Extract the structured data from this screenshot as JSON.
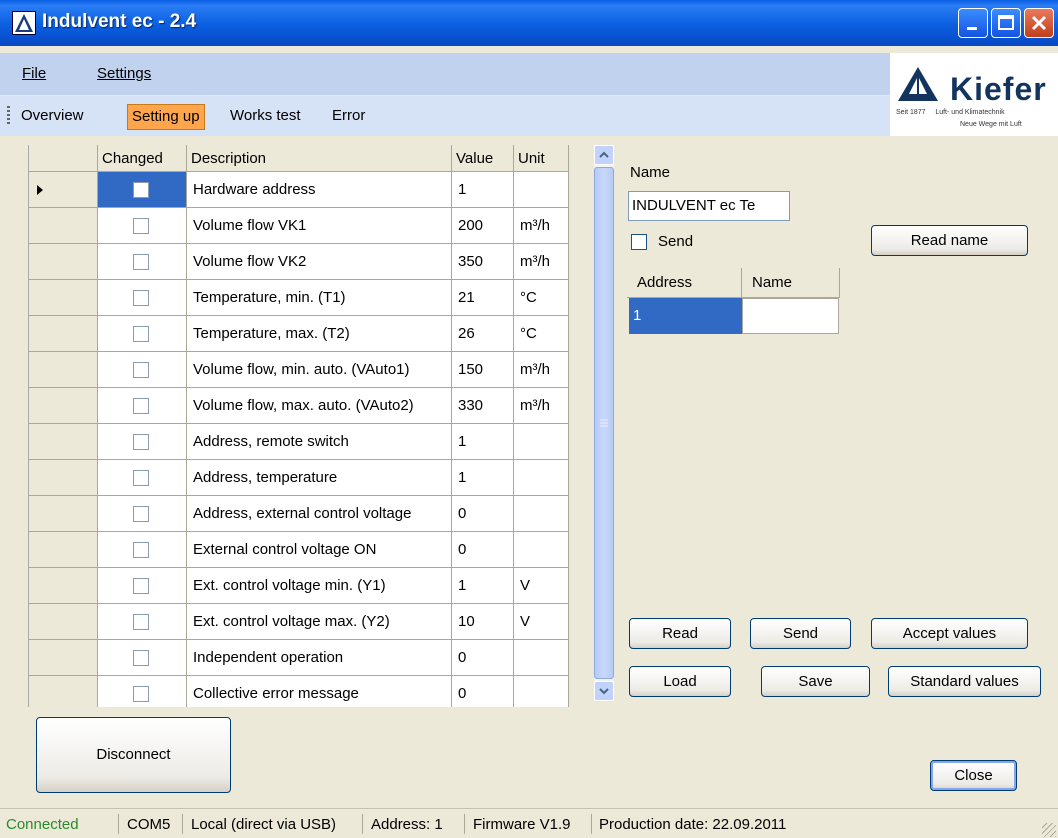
{
  "window": {
    "title": "Indulvent ec - 2.4"
  },
  "menu": {
    "file": "File",
    "settings": "Settings"
  },
  "toolbar": {
    "tabs": [
      {
        "label": "Overview",
        "active": false
      },
      {
        "label": "Setting up",
        "active": true
      },
      {
        "label": "Works test",
        "active": false
      },
      {
        "label": "Error",
        "active": false
      }
    ]
  },
  "logo": {
    "name": "Kiefer",
    "line1": "Seit 1877",
    "line2": "Luft- und Klimatechnik",
    "line3": "Neue Wege mit Luft"
  },
  "grid": {
    "headers": {
      "changed": "Changed",
      "description": "Description",
      "value": "Value",
      "unit": "Unit"
    },
    "rows": [
      {
        "description": "Hardware address",
        "value": "1",
        "unit": ""
      },
      {
        "description": "Volume flow VK1",
        "value": "200",
        "unit": "m³/h"
      },
      {
        "description": "Volume flow VK2",
        "value": "350",
        "unit": "m³/h"
      },
      {
        "description": "Temperature, min. (T1)",
        "value": "21",
        "unit": "°C"
      },
      {
        "description": "Temperature, max. (T2)",
        "value": "26",
        "unit": "°C"
      },
      {
        "description": "Volume flow, min. auto. (VAuto1)",
        "value": "150",
        "unit": "m³/h"
      },
      {
        "description": "Volume flow, max. auto. (VAuto2)",
        "value": "330",
        "unit": "m³/h"
      },
      {
        "description": "Address, remote switch",
        "value": "1",
        "unit": ""
      },
      {
        "description": "Address, temperature",
        "value": "1",
        "unit": ""
      },
      {
        "description": "Address, external control voltage",
        "value": "0",
        "unit": ""
      },
      {
        "description": "External control voltage ON",
        "value": "0",
        "unit": ""
      },
      {
        "description": "Ext. control voltage min. (Y1)",
        "value": "1",
        "unit": "V"
      },
      {
        "description": "Ext. control voltage max. (Y2)",
        "value": "10",
        "unit": "V"
      },
      {
        "description": "Independent operation",
        "value": "0",
        "unit": ""
      },
      {
        "description": "Collective error message",
        "value": "0",
        "unit": ""
      }
    ]
  },
  "right": {
    "name_label": "Name",
    "name_value": "INDULVENT ec Te",
    "send_label": "Send",
    "read_name": "Read name",
    "addr_headers": {
      "address": "Address",
      "name": "Name"
    },
    "addr_row": {
      "address": "1",
      "name": ""
    }
  },
  "buttons": {
    "read": "Read",
    "send": "Send",
    "accept": "Accept values",
    "load": "Load",
    "save": "Save",
    "standard": "Standard values",
    "disconnect": "Disconnect",
    "close": "Close"
  },
  "status": {
    "connected": "Connected",
    "port": "COM5",
    "mode": "Local (direct via USB)",
    "address": "Address: 1",
    "firmware": "Firmware V1.9",
    "production": "Production date: 22.09.2011"
  }
}
